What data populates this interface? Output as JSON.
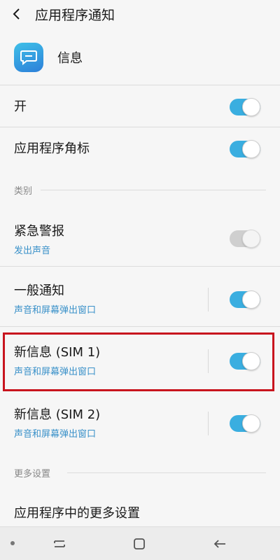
{
  "header": {
    "title": "应用程序通知"
  },
  "app": {
    "name": "信息"
  },
  "rows": {
    "on": {
      "title": "开",
      "state": true
    },
    "badge": {
      "title": "应用程序角标",
      "state": true
    },
    "emergency": {
      "title": "紧急警报",
      "subtitle": "发出声音",
      "state": true,
      "disabled": true
    },
    "general": {
      "title": "一般通知",
      "subtitle": "声音和屏幕弹出窗口",
      "state": true
    },
    "sim1": {
      "title": "新信息 (SIM 1)",
      "subtitle": "声音和屏幕弹出窗口",
      "state": true
    },
    "sim2": {
      "title": "新信息 (SIM 2)",
      "subtitle": "声音和屏幕弹出窗口",
      "state": true
    },
    "more": {
      "title": "应用程序中的更多设置"
    }
  },
  "sections": {
    "category": "类别",
    "more_settings": "更多设置"
  },
  "colors": {
    "accent": "#3aaee0",
    "highlight": "#c8141e",
    "subtitle": "#3a91c9"
  },
  "icons": [
    "back-arrow-icon",
    "chat-bubble-icon",
    "recent-apps-icon",
    "home-icon",
    "back-icon"
  ]
}
